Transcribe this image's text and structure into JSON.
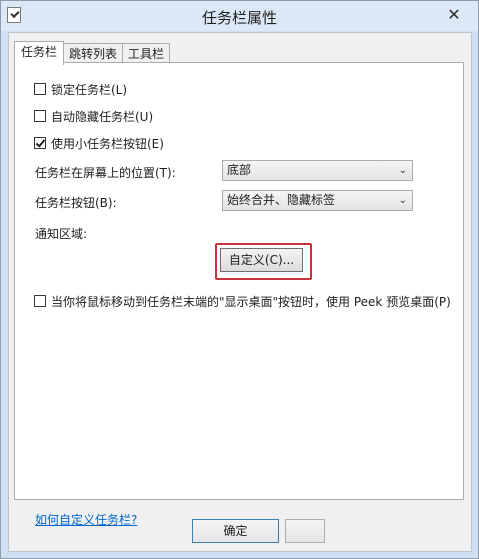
{
  "window": {
    "title": "任务栏属性",
    "close_glyph": "✕"
  },
  "tabs": [
    {
      "label": "任务栏",
      "active": true
    },
    {
      "label": "跳转列表",
      "active": false
    },
    {
      "label": "工具栏",
      "active": false
    }
  ],
  "options": {
    "lock_taskbar": {
      "label": "锁定任务栏(L)",
      "checked": false
    },
    "auto_hide": {
      "label": "自动隐藏任务栏(U)",
      "checked": false
    },
    "small_buttons": {
      "label": "使用小任务栏按钮(E)",
      "checked": true
    }
  },
  "location": {
    "label": "任务栏在屏幕上的位置(T):",
    "value": "底部"
  },
  "buttons_combine": {
    "label": "任务栏按钮(B):",
    "value": "始终合并、隐藏标签"
  },
  "notification_area": {
    "label": "通知区域:",
    "button_label": "自定义(C)..."
  },
  "peek": {
    "label": "当你将鼠标移动到任务栏末端的\"显示桌面\"按钮时，使用 Peek 预览桌面(P)",
    "checked": false
  },
  "help_link": "如何自定义任务栏?",
  "footer": {
    "ok_label": "确定",
    "cancel_label": ""
  },
  "colors": {
    "highlight": "#c8323a",
    "link": "#0066cc"
  }
}
